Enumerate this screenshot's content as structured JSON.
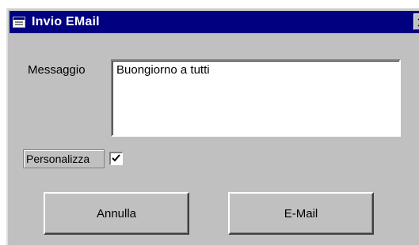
{
  "window": {
    "title": "Invio EMail",
    "icon": "form-icon",
    "title_bar_color": "#000080"
  },
  "form": {
    "message_label": "Messaggio",
    "message_value": "Buongiorno a tutti",
    "personalize_label": "Personalizza",
    "personalize_checked": true
  },
  "buttons": {
    "cancel_label": "Annulla",
    "email_label": "E-Mail"
  }
}
